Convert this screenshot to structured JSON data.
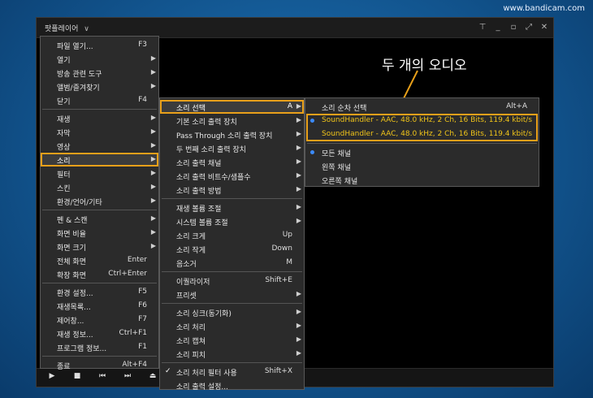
{
  "watermark": "www.bandicam.com",
  "window": {
    "title": "팟플레이어",
    "chevron": "∨",
    "controls": [
      "pin-icon",
      "minimize-icon",
      "restore-icon",
      "fullscreen-icon",
      "close-icon"
    ]
  },
  "annotation": "두 개의 오디오",
  "main_menu": [
    {
      "label": "파일 열기...",
      "shortcut": "F3"
    },
    {
      "label": "열기",
      "arrow": true
    },
    {
      "label": "방송 관련 도구",
      "arrow": true
    },
    {
      "label": "앨범/즐겨찾기",
      "arrow": true
    },
    {
      "label": "닫기",
      "shortcut": "F4"
    },
    {
      "sep": true
    },
    {
      "label": "재생",
      "arrow": true
    },
    {
      "label": "자막",
      "arrow": true
    },
    {
      "label": "영상",
      "arrow": true
    },
    {
      "label": "소리",
      "arrow": true,
      "highlight": true
    },
    {
      "label": "필터",
      "arrow": true
    },
    {
      "label": "스킨",
      "arrow": true
    },
    {
      "label": "환경/언어/기타",
      "arrow": true
    },
    {
      "sep": true
    },
    {
      "label": "펜 & 스캔",
      "arrow": true
    },
    {
      "label": "화면 비율",
      "arrow": true
    },
    {
      "label": "화면 크기",
      "arrow": true
    },
    {
      "label": "전체 화면",
      "shortcut": "Enter"
    },
    {
      "label": "확장 화면",
      "shortcut": "Ctrl+Enter"
    },
    {
      "sep": true
    },
    {
      "label": "환경 설정...",
      "shortcut": "F5"
    },
    {
      "label": "재생목록...",
      "shortcut": "F6"
    },
    {
      "label": "제어창...",
      "shortcut": "F7"
    },
    {
      "label": "재생 정보...",
      "shortcut": "Ctrl+F1"
    },
    {
      "label": "프로그램 정보...",
      "shortcut": "F1"
    },
    {
      "sep": true
    },
    {
      "label": "종료",
      "shortcut": "Alt+F4"
    }
  ],
  "sound_menu": [
    {
      "label": "소리 선택",
      "shortcut": "A",
      "arrow": true,
      "highlight": true
    },
    {
      "label": "기본 소리 출력 장치",
      "arrow": true
    },
    {
      "label": "Pass Through 소리 출력 장치",
      "arrow": true
    },
    {
      "label": "두 번째 소리 출력 장치",
      "arrow": true
    },
    {
      "label": "소리 출력 채널",
      "arrow": true
    },
    {
      "label": "소리 출력 비트수/샘플수",
      "arrow": true
    },
    {
      "label": "소리 출력 방법",
      "arrow": true
    },
    {
      "sep": true
    },
    {
      "label": "재생 볼륨 조절",
      "arrow": true
    },
    {
      "label": "시스템 볼륨 조절",
      "arrow": true
    },
    {
      "label": "소리 크게",
      "shortcut": "Up"
    },
    {
      "label": "소리 작게",
      "shortcut": "Down"
    },
    {
      "label": "음소거",
      "shortcut": "M"
    },
    {
      "sep": true
    },
    {
      "label": "이퀄라이저",
      "shortcut": "Shift+E"
    },
    {
      "label": "프리셋",
      "arrow": true
    },
    {
      "sep": true
    },
    {
      "label": "소리 싱크(동기화)",
      "arrow": true
    },
    {
      "label": "소리 처리",
      "arrow": true
    },
    {
      "label": "소리 캡쳐",
      "arrow": true
    },
    {
      "label": "소리 피치",
      "arrow": true
    },
    {
      "sep": true
    },
    {
      "label": "소리 처리 필터 사용",
      "shortcut": "Shift+X",
      "check": true
    },
    {
      "label": "소리 출력 설정..."
    }
  ],
  "select_menu": [
    {
      "label": "소리 순차 선택",
      "shortcut": "Alt+A"
    },
    {
      "label": "SoundHandler - AAC, 48.0 kHz, 2 Ch, 16 Bits, 119.4 kbit/s",
      "radio": true,
      "selected": true
    },
    {
      "label": "SoundHandler - AAC, 48.0 kHz, 2 Ch, 16 Bits, 119.4 kbit/s"
    },
    {
      "sep": true
    },
    {
      "label": "모든 채널",
      "radio": true
    },
    {
      "label": "왼쪽 채널"
    },
    {
      "label": "오른쪽 채널"
    }
  ],
  "playback_controls": [
    "play-icon",
    "stop-icon",
    "previous-icon",
    "next-icon",
    "eject-icon"
  ]
}
